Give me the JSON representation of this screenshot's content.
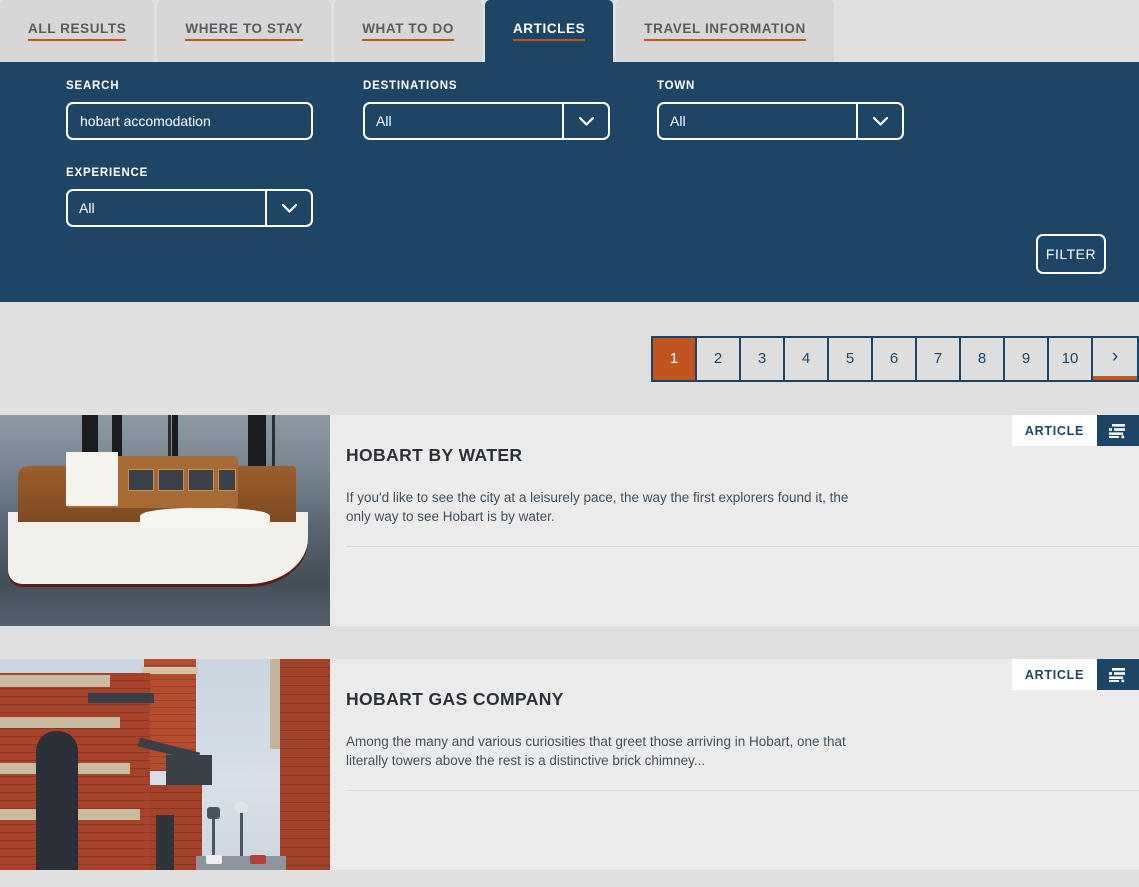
{
  "theme": {
    "navy": "#1d4565",
    "orange": "#c2541f",
    "page_bg": "#e0e0e0",
    "tab_bg": "#d6d6d6",
    "card_bg": "#ebebeb"
  },
  "tabs": [
    {
      "label": "ALL RESULTS",
      "active": false
    },
    {
      "label": "WHERE TO STAY",
      "active": false
    },
    {
      "label": "WHAT TO DO",
      "active": false
    },
    {
      "label": "ARTICLES",
      "active": true
    },
    {
      "label": "TRAVEL INFORMATION",
      "active": false
    }
  ],
  "filters": {
    "search": {
      "label": "SEARCH",
      "value": "hobart accomodation",
      "placeholder": "Search"
    },
    "destinations": {
      "label": "DESTINATIONS",
      "value": "All",
      "icon": "chevron-down-icon"
    },
    "town": {
      "label": "TOWN",
      "value": "All",
      "icon": "chevron-down-icon"
    },
    "experience": {
      "label": "EXPERIENCE",
      "value": "All",
      "icon": "chevron-down-icon"
    },
    "filter_button": "FILTER"
  },
  "pagination": {
    "pages": [
      "1",
      "2",
      "3",
      "4",
      "5",
      "6",
      "7",
      "8",
      "9",
      "10"
    ],
    "active_page": "1",
    "next_label": "›"
  },
  "results": [
    {
      "title": "HOBART BY WATER",
      "description": "If you'd like to see the city at a leisurely pace, the way the first explorers found it, the only way to see Hobart is by water.",
      "badge": "ARTICLE",
      "badge_icon": "article-lines-icon",
      "image_alt": "wooden-boat-moored-on-water"
    },
    {
      "title": "HOBART GAS COMPANY",
      "description": "Among the many and various curiosities that greet those arriving in Hobart, one that literally towers above the rest is a distinctive brick chimney...",
      "badge": "ARTICLE",
      "badge_icon": "article-lines-icon",
      "image_alt": "red-brick-building-with-chimney"
    }
  ]
}
